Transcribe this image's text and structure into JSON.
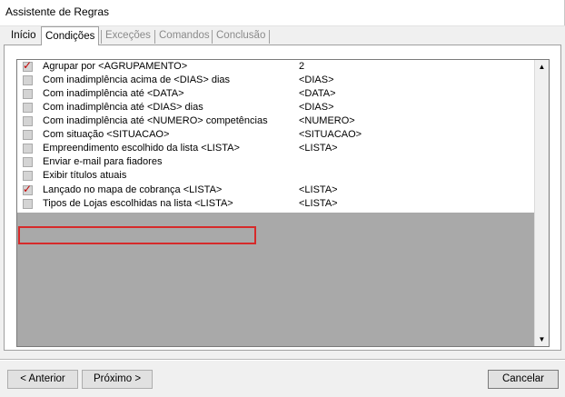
{
  "window": {
    "title": "Assistente de Regras"
  },
  "tabs": [
    {
      "label": "Início",
      "state": "enabled"
    },
    {
      "label": "Condições",
      "state": "active"
    },
    {
      "label": "Exceções",
      "state": "disabled"
    },
    {
      "label": "Comandos",
      "state": "disabled"
    },
    {
      "label": "Conclusão",
      "state": "disabled"
    }
  ],
  "conditions": [
    {
      "label": "Agrupar por <AGRUPAMENTO>",
      "value": "2",
      "checked": true
    },
    {
      "label": "Com inadimplência acima de <DIAS> dias",
      "value": "<DIAS>",
      "checked": false
    },
    {
      "label": "Com inadimplência até <DATA>",
      "value": "<DATA>",
      "checked": false
    },
    {
      "label": "Com inadimplência até <DIAS>  dias",
      "value": "<DIAS>",
      "checked": false
    },
    {
      "label": "Com inadimplência até <NUMERO> competências",
      "value": "<NUMERO>",
      "checked": false
    },
    {
      "label": "Com situação <SITUACAO>",
      "value": "<SITUACAO>",
      "checked": false
    },
    {
      "label": "Empreendimento escolhido da lista <LISTA>",
      "value": "<LISTA>",
      "checked": false
    },
    {
      "label": "Enviar e-mail para fiadores",
      "value": "",
      "checked": false
    },
    {
      "label": "Exibir títulos atuais",
      "value": "",
      "checked": false
    },
    {
      "label": "Lançado no mapa de cobrança <LISTA>",
      "value": "<LISTA>",
      "checked": true
    },
    {
      "label": "Tipos de Lojas escolhidas na lista <LISTA>",
      "value": "<LISTA>",
      "checked": false
    }
  ],
  "buttons": {
    "back": "< Anterior",
    "next": "Próximo >",
    "cancel": "Cancelar"
  },
  "colors": {
    "check_mark": "#c20000",
    "highlight_box": "#d62a2a",
    "list_empty_area": "#a9a9a9"
  }
}
